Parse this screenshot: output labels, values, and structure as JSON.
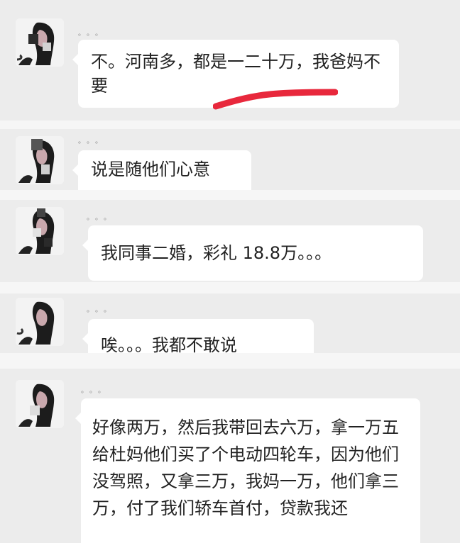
{
  "messages": [
    {
      "sender": "contact-avatar",
      "status": "。。。",
      "text": "不。河南多，都是一二十万，我爸妈不要"
    },
    {
      "sender": "contact-avatar",
      "status": "。。。",
      "text": "说是随他们心意"
    },
    {
      "sender": "contact-avatar",
      "status": "。。。",
      "text": "我同事二婚，彩礼 18.8万。。。"
    },
    {
      "sender": "contact-avatar",
      "status": "。。。",
      "text": "唉。。。我都不敢说"
    },
    {
      "sender": "contact-avatar",
      "status": "。。。",
      "text": "好像两万，然后我带回去六万，拿一万五给杜妈他们买了个电动四轮车，因为他们没驾照，又拿三万，我妈一万，他们拿三万，付了我们轿车首付，贷款我还"
    }
  ],
  "annotation": {
    "color": "#e8283c",
    "icon": "red-underline"
  },
  "theme": {
    "background": "#e9e9e9",
    "bubble": "#ffffff",
    "text": "#222222"
  }
}
